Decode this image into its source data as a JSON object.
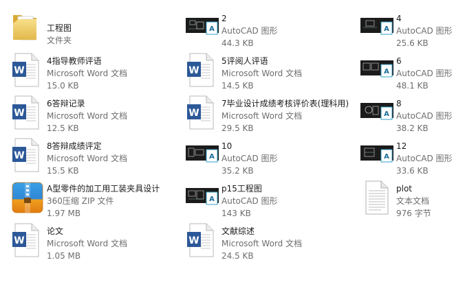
{
  "files": [
    {
      "id": "f1",
      "name": "工程图",
      "type": "文件夹",
      "size": "",
      "icon": "folder-icon"
    },
    {
      "id": "f2",
      "name": "2",
      "type": "AutoCAD 图形",
      "size": "44.3 KB",
      "icon": "autocad-drawing-icon"
    },
    {
      "id": "f3",
      "name": "4",
      "type": "AutoCAD 图形",
      "size": "25.6 KB",
      "icon": "autocad-drawing-icon"
    },
    {
      "id": "f4",
      "name": "4指导教师评语",
      "type": "Microsoft Word 文档",
      "size": "15.0 KB",
      "icon": "word-document-icon"
    },
    {
      "id": "f5",
      "name": "5评阅人评语",
      "type": "Microsoft Word 文档",
      "size": "14.5 KB",
      "icon": "word-document-icon"
    },
    {
      "id": "f6",
      "name": "6",
      "type": "AutoCAD 图形",
      "size": "48.1 KB",
      "icon": "autocad-drawing-icon"
    },
    {
      "id": "f7",
      "name": "6答辩记录",
      "type": "Microsoft Word 文档",
      "size": "12.5 KB",
      "icon": "word-document-icon"
    },
    {
      "id": "f8",
      "name": "7毕业设计成绩考核评价表(理科用)",
      "type": "Microsoft Word 文档",
      "size": "29.5 KB",
      "icon": "word-document-icon"
    },
    {
      "id": "f9",
      "name": "8",
      "type": "AutoCAD 图形",
      "size": "38.2 KB",
      "icon": "autocad-drawing-icon"
    },
    {
      "id": "f10",
      "name": "8答辩成绩评定",
      "type": "Microsoft Word 文档",
      "size": "15.5 KB",
      "icon": "word-document-icon"
    },
    {
      "id": "f11",
      "name": "10",
      "type": "AutoCAD 图形",
      "size": "35.2 KB",
      "icon": "autocad-drawing-icon"
    },
    {
      "id": "f12",
      "name": "12",
      "type": "AutoCAD 图形",
      "size": "33.6 KB",
      "icon": "autocad-drawing-icon"
    },
    {
      "id": "f13",
      "name": "A型零件的加工用工装夹具设计",
      "type": "360压缩 ZIP 文件",
      "size": "1.97 MB",
      "icon": "zip-archive-icon"
    },
    {
      "id": "f14",
      "name": "p15工程图",
      "type": "AutoCAD 图形",
      "size": "143 KB",
      "icon": "autocad-drawing-icon"
    },
    {
      "id": "f15",
      "name": "plot",
      "type": "文本文档",
      "size": "976 字节",
      "icon": "text-document-icon"
    },
    {
      "id": "f16",
      "name": "论文",
      "type": "Microsoft Word 文档",
      "size": "1.05 MB",
      "icon": "word-document-icon"
    },
    {
      "id": "f17",
      "name": "文献综述",
      "type": "Microsoft Word 文档",
      "size": "24.5 KB",
      "icon": "word-document-icon"
    }
  ]
}
